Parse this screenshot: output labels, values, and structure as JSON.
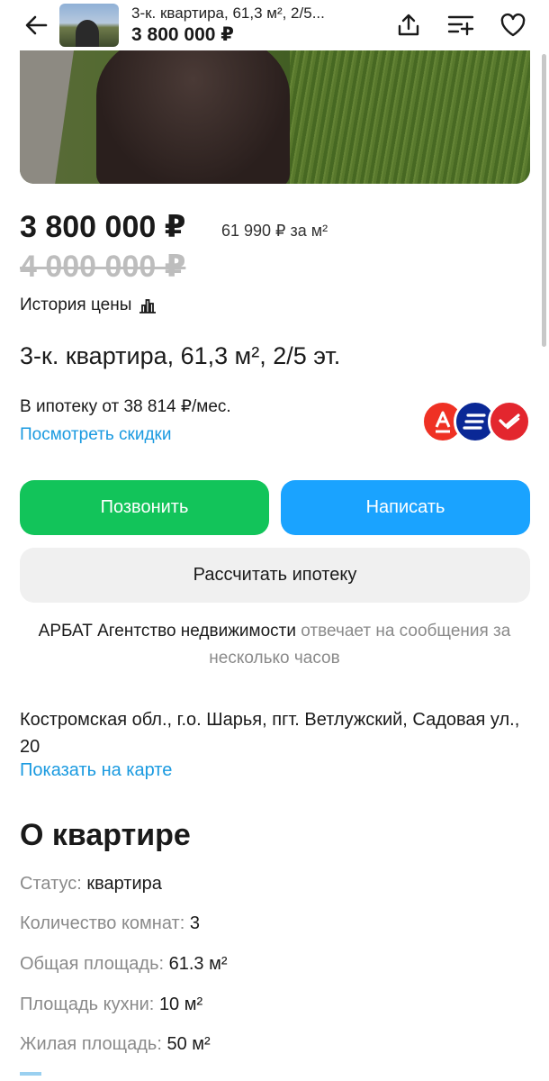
{
  "header": {
    "title": "3-к. квартира, 61,3 м², 2/5...",
    "price": "3 800 000 ₽",
    "icons": [
      "arrow-back-icon",
      "share-icon",
      "compare-icon",
      "favorite-heart-icon"
    ]
  },
  "listing": {
    "price": "3 800 000 ₽",
    "price_per_m2": "61 990 ₽ за м²",
    "old_price": "4 000 000 ₽",
    "price_history_label": "История цены",
    "title": "3-к. квартира, 61,3 м², 2/5 эт.",
    "mortgage_text": "В ипотеку от 38 814 ₽/мес.",
    "discounts_link": "Посмотреть скидки",
    "banks": [
      {
        "name": "alfa-bank-logo",
        "letter": "А",
        "color": "#ef3124"
      },
      {
        "name": "vtb-logo",
        "letter": "≡",
        "color": "#0a2896"
      },
      {
        "name": "sovcombank-logo",
        "letter": "✓",
        "color": "#e3262e"
      }
    ]
  },
  "actions": {
    "call": "Позвонить",
    "write": "Написать",
    "mortgage": "Рассчитать ипотеку"
  },
  "agency": {
    "name": "АРБАТ Агентство недвижимости",
    "reply": "отвечает на сообщения за несколько часов"
  },
  "location": {
    "address": "Костромская обл., г.о. Шарья, пгт. Ветлужский, Садовая ул., 20",
    "show_map": "Показать на карте"
  },
  "about": {
    "heading": "О квартире",
    "params": [
      {
        "key": "Статус:",
        "value": "квартира"
      },
      {
        "key": "Количество комнат:",
        "value": "3"
      },
      {
        "key": "Общая площадь:",
        "value": "61.3 м²"
      },
      {
        "key": "Площадь кухни:",
        "value": "10 м²"
      },
      {
        "key": "Жилая площадь:",
        "value": "50 м²"
      }
    ]
  },
  "colors": {
    "call_button": "#12c45a",
    "write_button": "#1aa3ff",
    "link": "#1a9ae0"
  }
}
